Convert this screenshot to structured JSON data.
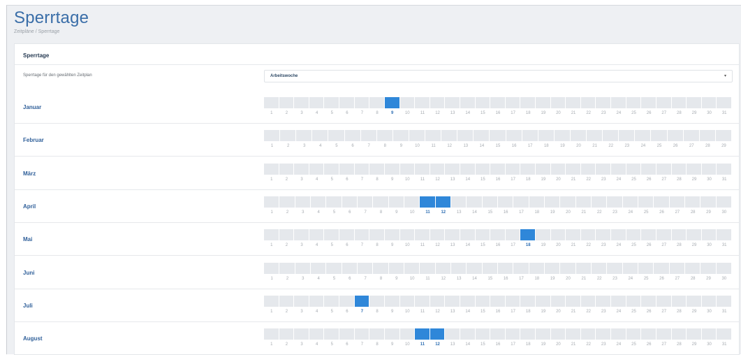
{
  "header": {
    "title": "Sperrtage",
    "breadcrumb": "Zeitpläne / Sperrtage"
  },
  "panel": {
    "title": "Sperrtage",
    "schedule_label": "Sperrtage für den gewählten Zeitplan",
    "schedule_value": "Arbeitswoche"
  },
  "colors": {
    "blocked": "#2f87d9",
    "empty": "#e5e8ec",
    "title": "#3a6ea8"
  },
  "months": [
    {
      "name": "Januar",
      "days": 31,
      "blocked": [
        9
      ]
    },
    {
      "name": "Februar",
      "days": 29,
      "blocked": []
    },
    {
      "name": "März",
      "days": 31,
      "blocked": []
    },
    {
      "name": "April",
      "days": 30,
      "blocked": [
        11,
        12
      ]
    },
    {
      "name": "Mai",
      "days": 31,
      "blocked": [
        18
      ]
    },
    {
      "name": "Juni",
      "days": 30,
      "blocked": []
    },
    {
      "name": "Juli",
      "days": 31,
      "blocked": [
        7
      ]
    },
    {
      "name": "August",
      "days": 31,
      "blocked": [
        11,
        12
      ]
    }
  ]
}
